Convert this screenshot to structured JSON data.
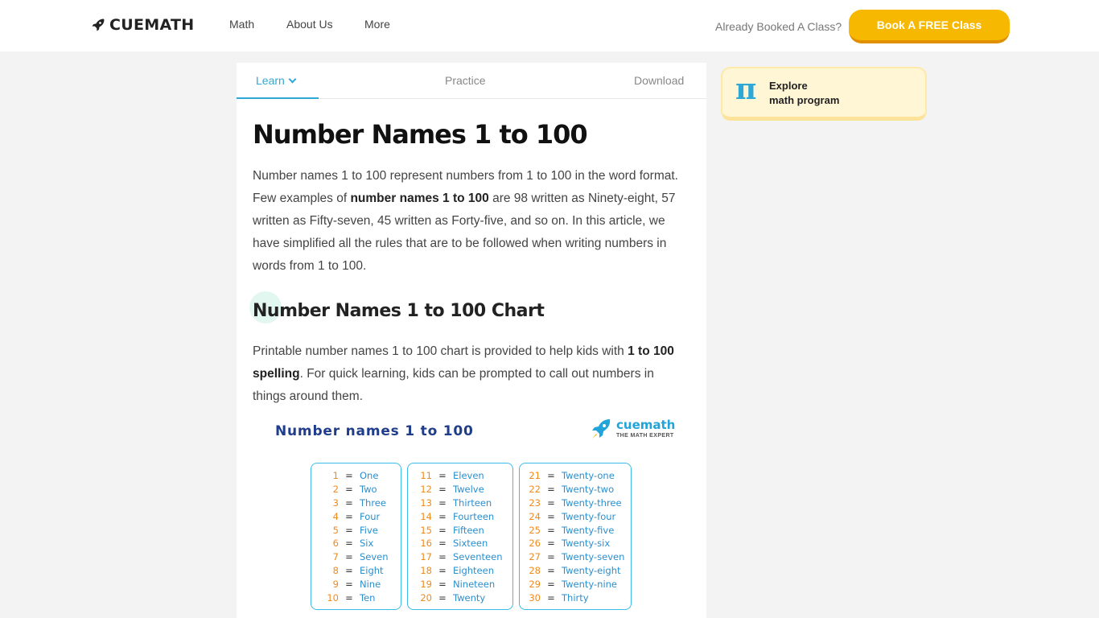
{
  "header": {
    "logo_text": "CUEMATH",
    "nav": [
      "Math",
      "About Us",
      "More"
    ],
    "already_booked": "Already Booked A Class?",
    "book_button": "Book A FREE Class"
  },
  "tabs": {
    "learn": "Learn",
    "practice": "Practice",
    "download": "Download"
  },
  "article": {
    "title": "Number Names 1 to 100",
    "intro_before": "Number names 1 to 100 represent numbers from 1 to 100 in the word format. Few examples of ",
    "intro_bold": "number names 1 to 100",
    "intro_after": " are 98 written as Ninety-eight, 57 written as Fifty-seven, 45 written as Forty-five, and so on. In this article, we have simplified all the rules that are to be followed when writing numbers in words from 1 to 100.",
    "subtitle": "Number Names 1 to 100 Chart",
    "chart_before": "Printable number names 1 to 100 chart is provided to help kids with ",
    "chart_bold": "1 to 100 spelling",
    "chart_after": ". For quick learning, kids can be prompted to call out numbers in things around them."
  },
  "sidebar": {
    "explore_line1": "Explore",
    "explore_line2": "math program",
    "pi_symbol": "π"
  },
  "chart_image": {
    "title": "Number names 1 to 100",
    "brand": "cuemath",
    "tagline": "THE MATH EXPERT",
    "equals": "=",
    "columns": [
      [
        [
          "1",
          "One"
        ],
        [
          "2",
          "Two"
        ],
        [
          "3",
          "Three"
        ],
        [
          "4",
          "Four"
        ],
        [
          "5",
          "Five"
        ],
        [
          "6",
          "Six"
        ],
        [
          "7",
          "Seven"
        ],
        [
          "8",
          "Eight"
        ],
        [
          "9",
          "Nine"
        ],
        [
          "10",
          "Ten"
        ]
      ],
      [
        [
          "11",
          "Eleven"
        ],
        [
          "12",
          "Twelve"
        ],
        [
          "13",
          "Thirteen"
        ],
        [
          "14",
          "Fourteen"
        ],
        [
          "15",
          "Fifteen"
        ],
        [
          "16",
          "Sixteen"
        ],
        [
          "17",
          "Seventeen"
        ],
        [
          "18",
          "Eighteen"
        ],
        [
          "19",
          "Nineteen"
        ],
        [
          "20",
          "Twenty"
        ]
      ],
      [
        [
          "21",
          "Twenty-one"
        ],
        [
          "22",
          "Twenty-two"
        ],
        [
          "23",
          "Twenty-three"
        ],
        [
          "24",
          "Twenty-four"
        ],
        [
          "25",
          "Twenty-five"
        ],
        [
          "26",
          "Twenty-six"
        ],
        [
          "27",
          "Twenty-seven"
        ],
        [
          "28",
          "Twenty-eight"
        ],
        [
          "29",
          "Twenty-nine"
        ],
        [
          "30",
          "Thirty"
        ]
      ]
    ]
  },
  "colors": {
    "accent": "#2ea8d6",
    "cta": "#f6b800",
    "explore_bg": "#fff6d6",
    "number_orange": "#f08a1c"
  }
}
